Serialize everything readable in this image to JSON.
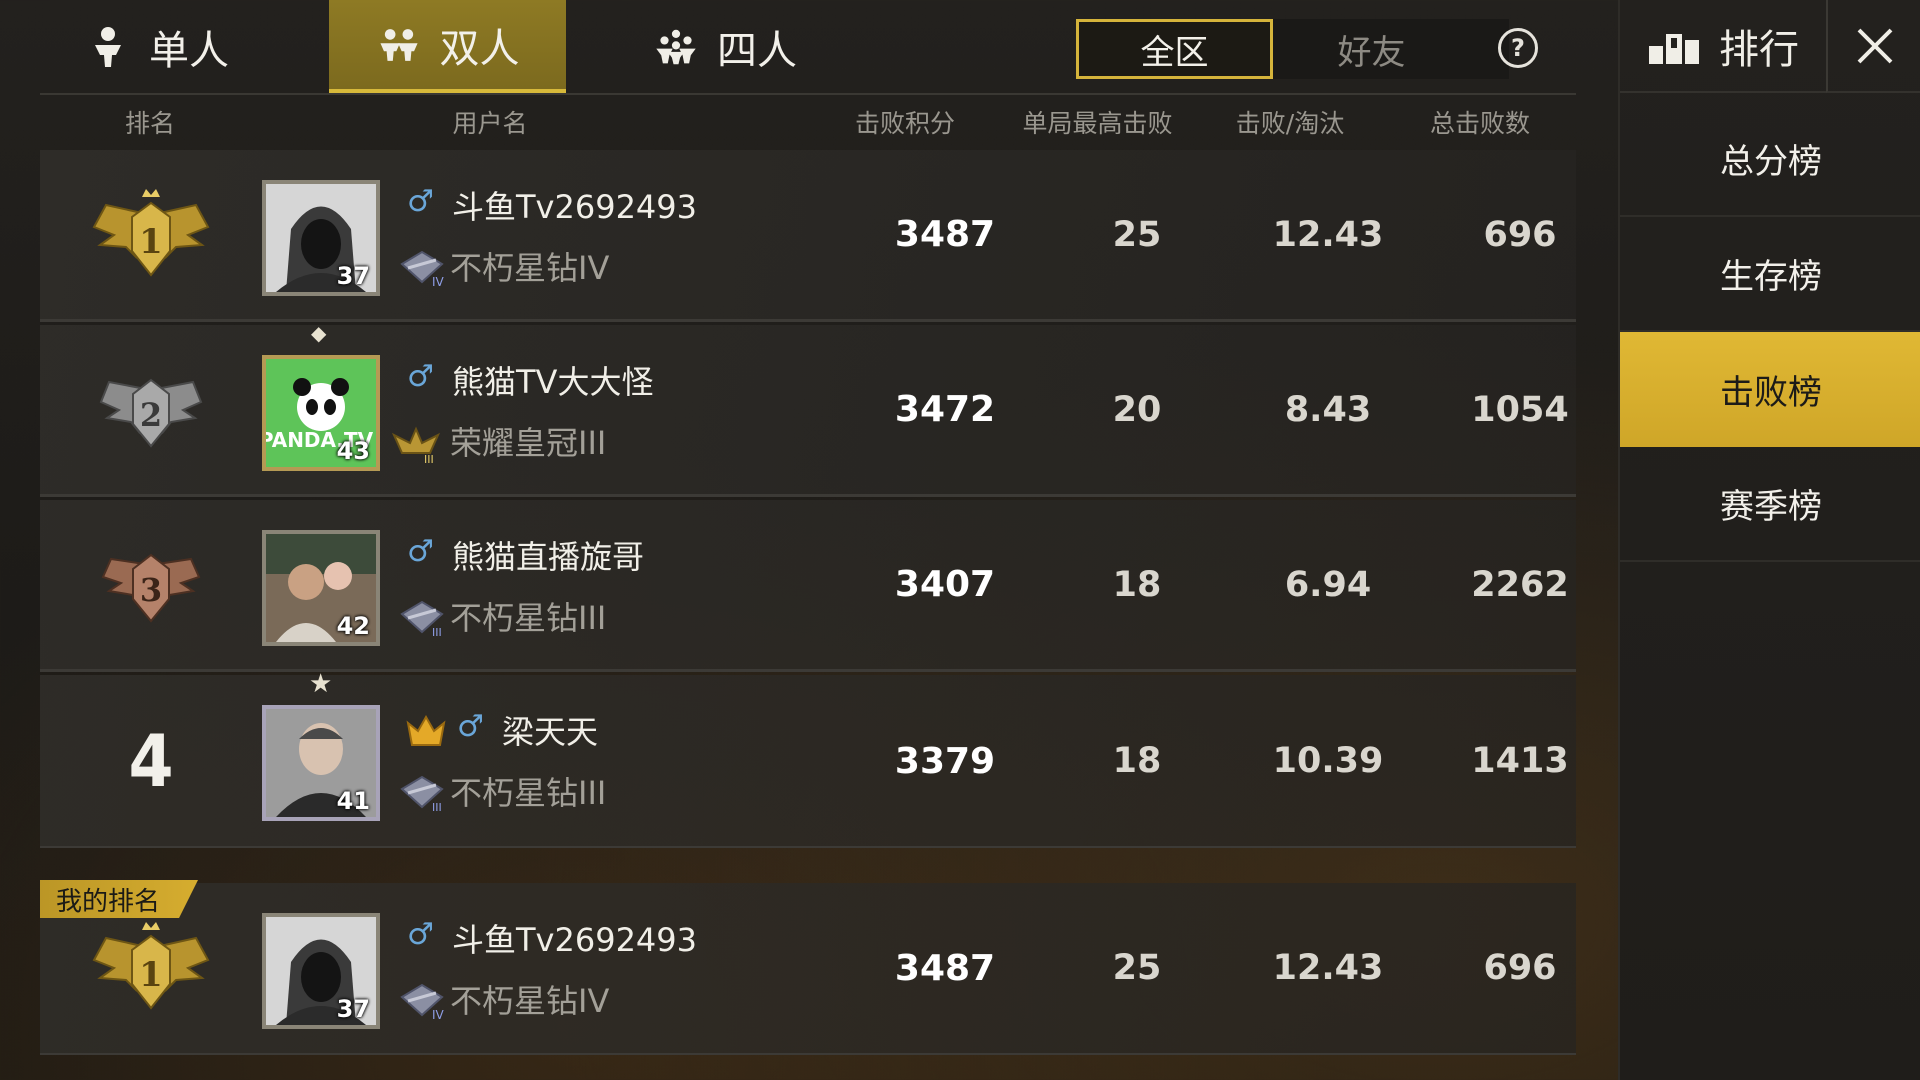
{
  "tabs": {
    "solo": "单人",
    "duo": "双人",
    "squad": "四人",
    "active": "duo"
  },
  "region_filter": {
    "all": "全区",
    "friends": "好友",
    "active": "all"
  },
  "columns": {
    "rank": "排名",
    "username": "用户名",
    "score": "击败积分",
    "max_kills": "单局最高击败",
    "ratio": "击败/淘汰",
    "total_kills": "总击败数"
  },
  "rows": [
    {
      "rank": "1",
      "name": "斗鱼Tv2692493",
      "gender": "♂",
      "tier": "不朽星钻IV",
      "level": "37",
      "score": "3487",
      "max_kills": "25",
      "ratio": "12.43",
      "total_kills": "696"
    },
    {
      "rank": "2",
      "name": "熊猫TV大大怪",
      "gender": "♂",
      "tier": "荣耀皇冠III",
      "level": "43",
      "score": "3472",
      "max_kills": "20",
      "ratio": "8.43",
      "total_kills": "1054"
    },
    {
      "rank": "3",
      "name": "熊猫直播旋哥",
      "gender": "♂",
      "tier": "不朽星钻III",
      "level": "42",
      "score": "3407",
      "max_kills": "18",
      "ratio": "6.94",
      "total_kills": "2262"
    },
    {
      "rank": "4",
      "name": "梁天天",
      "gender": "♂",
      "tier": "不朽星钻III",
      "level": "41",
      "score": "3379",
      "max_kills": "18",
      "ratio": "10.39",
      "total_kills": "1413"
    }
  ],
  "my_rank": {
    "label": "我的排名",
    "rank": "1",
    "name": "斗鱼Tv2692493",
    "gender": "♂",
    "tier": "不朽星钻IV",
    "level": "37",
    "score": "3487",
    "max_kills": "25",
    "ratio": "12.43",
    "total_kills": "696"
  },
  "side_panel": {
    "title": "排行",
    "boards": [
      "总分榜",
      "生存榜",
      "击败榜",
      "赛季榜"
    ],
    "active_index": 2
  },
  "colors": {
    "accent_gold": "#d7b93a",
    "active_board": "#e0b834",
    "gender_male": "#6aa6d8"
  }
}
